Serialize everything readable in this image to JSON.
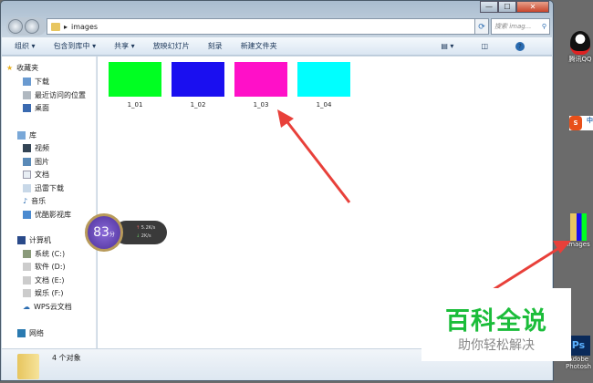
{
  "window": {
    "address": "images",
    "search_placeholder": "搜索 imag...",
    "controls": [
      "—",
      "☐",
      "✕"
    ]
  },
  "toolbar": {
    "items": [
      "组织 ▾",
      "包含到库中 ▾",
      "共享 ▾",
      "放映幻灯片",
      "刻录",
      "新建文件夹"
    ]
  },
  "sidebar": {
    "favorites": {
      "label": "收藏夹",
      "items": [
        "下载",
        "最近访问的位置",
        "桌面"
      ]
    },
    "library": {
      "label": "库",
      "items": [
        "视频",
        "图片",
        "文档",
        "迅雷下载",
        "音乐",
        "优酷影视库"
      ]
    },
    "computer": {
      "label": "计算机",
      "items": [
        "系统 (C:)",
        "软件 (D:)",
        "文档 (E:)",
        "娱乐 (F:)",
        "WPS云文档"
      ]
    },
    "network": {
      "label": "网络"
    }
  },
  "files": [
    {
      "name": "1_01",
      "color": "#00ff22"
    },
    {
      "name": "1_02",
      "color": "#1a0ff0"
    },
    {
      "name": "1_03",
      "color": "#ff10c8"
    },
    {
      "name": "1_04",
      "color": "#00ffff"
    }
  ],
  "status": {
    "count": "4 个对象"
  },
  "widget": {
    "score": "83",
    "unit": "分",
    "up": "5.2K/s",
    "down": "2K/s"
  },
  "desktop": {
    "qq": "腾讯QQ",
    "images": "images",
    "ps1": "Adobe",
    "ps2": "Photosh",
    "sogou": "中"
  },
  "watermark": {
    "title": "百科全说",
    "subtitle": "助你轻松解决"
  },
  "colors": {
    "arrow": "#e8403a",
    "watermark_green": "#1bbd3a"
  }
}
